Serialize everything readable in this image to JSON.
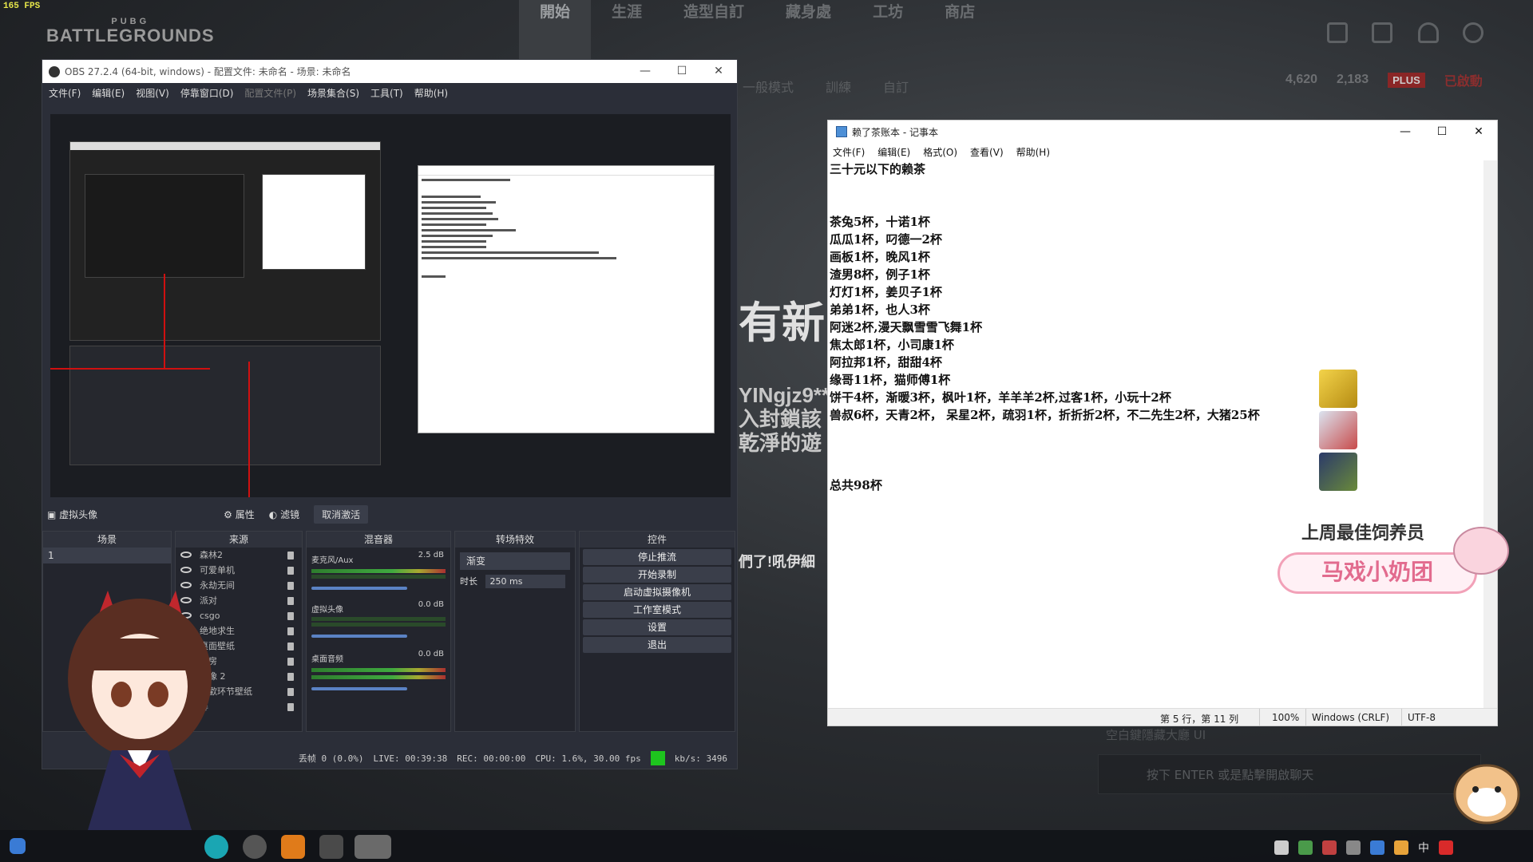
{
  "game": {
    "fps": "165 FPS",
    "logo_top": "PUBG",
    "logo_main": "BATTLEGROUNDS",
    "nav": [
      "開始",
      "生涯",
      "造型自訂",
      "藏身處",
      "工坊",
      "商店"
    ],
    "sub_nav": [
      "一般模式",
      "訓練",
      "自訂"
    ],
    "currency": [
      "4,620",
      "2,183"
    ],
    "plus_badge": "PLUS",
    "plus_status": "已啟動",
    "promo_title": "有新",
    "promo_name": "YINgjz9***",
    "promo_lines": [
      "入封鎖該",
      "乾淨的遊"
    ],
    "promo_banner": "們了!吼伊細",
    "chat_hint": "空白鍵隱藏大廳 UI",
    "chat_input": "按下 ENTER 或是點擊開啟聊天"
  },
  "obs": {
    "title": "OBS 27.2.4 (64-bit, windows) - 配置文件: 未命名 - 场景: 未命名",
    "menu": [
      "文件(F)",
      "编辑(E)",
      "视图(V)",
      "停靠窗口(D)",
      "配置文件(P)",
      "场景集合(S)",
      "工具(T)",
      "帮助(H)"
    ],
    "source_bar": {
      "selected": "虚拟头像",
      "props": "属性",
      "filters": "滤镜",
      "deactivate": "取消激活"
    },
    "docks": {
      "scenes": {
        "title": "场景",
        "items": [
          "1"
        ]
      },
      "sources": {
        "title": "来源",
        "items": [
          "森林2",
          "可爱单机",
          "永劫无间",
          "派对",
          "csgo",
          "绝地求生",
          "桌面壁纸",
          "暗房",
          "图像 2",
          "春歡环节壁纸",
          "屏"
        ]
      },
      "mixer": {
        "title": "混音器",
        "channels": [
          {
            "name": "麦克风/Aux",
            "db": "2.5 dB"
          },
          {
            "name": "虚拟头像",
            "db": "0.0 dB"
          },
          {
            "name": "桌面音频",
            "db": "0.0 dB"
          }
        ]
      },
      "transitions": {
        "title": "转场特效",
        "type": "渐变",
        "duration_label": "时长",
        "duration": "250 ms"
      },
      "controls": {
        "title": "控件",
        "buttons": [
          "停止推流",
          "开始录制",
          "启动虚拟摄像机",
          "工作室模式",
          "设置",
          "退出"
        ]
      }
    },
    "status": {
      "dropped": "丢帧 0 (0.0%)",
      "live": "LIVE: 00:39:38",
      "rec": "REC: 00:00:00",
      "cpu": "CPU: 1.6%, 30.00 fps",
      "kbs": "kb/s: 3496"
    }
  },
  "notepad": {
    "title": "赖了茶账本 - 记事本",
    "menu": [
      "文件(F)",
      "编辑(E)",
      "格式(O)",
      "查看(V)",
      "帮助(H)"
    ],
    "lines": [
      "三十元以下的赖茶",
      "",
      "",
      "茶兔5杯，十诺1杯",
      "瓜瓜1杯，叼德一2杯",
      "画板1杯，晚风1杯",
      "渣男8杯，例子1杯",
      "灯灯1杯，姜贝子1杯",
      "弟弟1杯，也人3杯",
      "阿迷2杯,漫天飘雪雪飞舞1杯",
      "焦太郎1杯，小司康1杯",
      "阿拉邦1杯，甜甜4杯",
      "缘哥11杯，猫师傅1杯",
      "饼干4杯，渐暖3杯，枫叶1杯，羊羊羊2杯,过客1杯，小玩十2杯",
      "兽叔6杯，天青2杯，  呆星2杯，疏羽1杯，折折折2杯，不二先生2杯，大猪25杯",
      "",
      "",
      "",
      "总共98杯"
    ],
    "status": {
      "position": "第 5 行，第 11 列",
      "zoom": "100%",
      "eol": "Windows (CRLF)",
      "encoding": "UTF-8"
    }
  },
  "overlay": {
    "fan_title": "上周最佳饲养员",
    "fan_name": "马戏小奶团",
    "ime": "中"
  }
}
